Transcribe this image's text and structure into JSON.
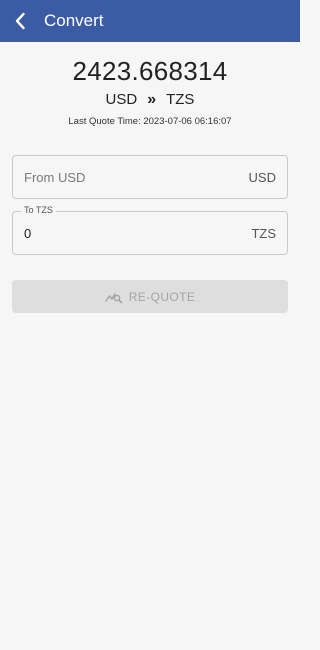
{
  "app_bar": {
    "title": "Convert",
    "back_icon": "chevron-left-icon",
    "background_color": "#3b5ba5"
  },
  "rate": {
    "value": "2423.668314",
    "from_currency": "USD",
    "separator": "»",
    "to_currency": "TZS",
    "quote_time": "Last Quote Time: 2023-07-06 06:16:07"
  },
  "from_field": {
    "placeholder": "From USD",
    "value": "",
    "suffix": "USD"
  },
  "to_field": {
    "label": "To TZS",
    "value": "0",
    "suffix": "TZS"
  },
  "requote_button": {
    "label": "RE-QUOTE",
    "icon": "chart-search-icon",
    "enabled": false
  }
}
